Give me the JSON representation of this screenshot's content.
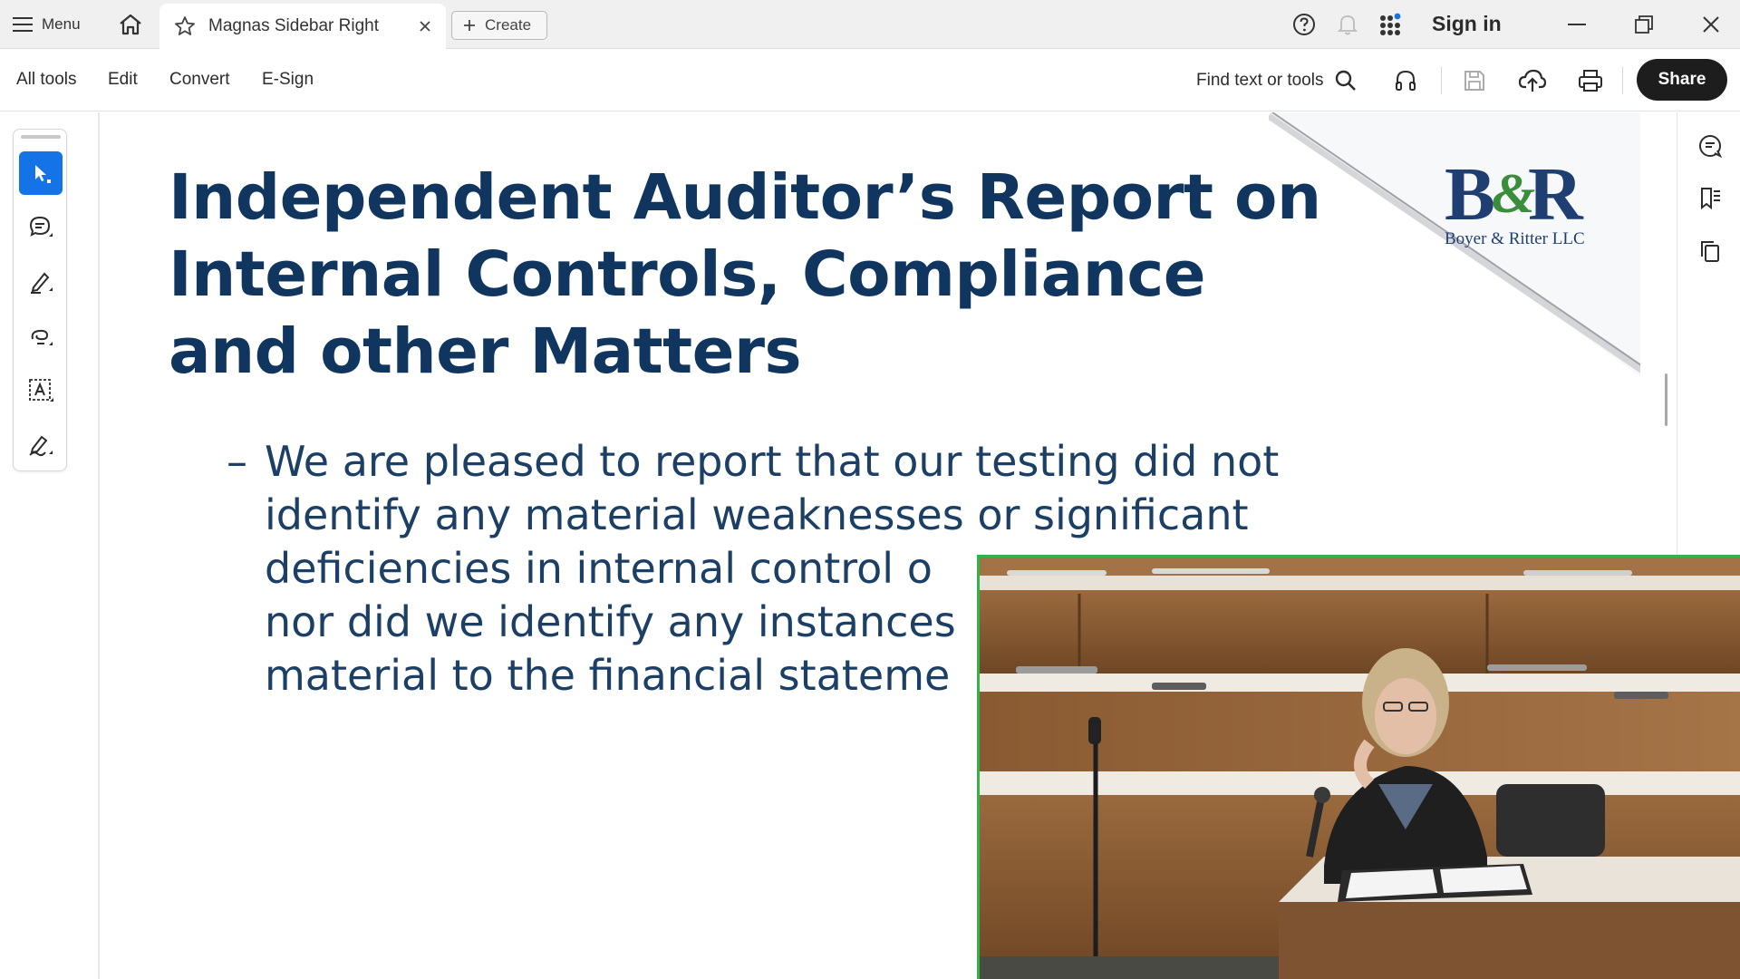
{
  "titlebar": {
    "menu_label": "Menu",
    "tab_title": "Magnas Sidebar Right",
    "create_label": "Create",
    "sign_in_label": "Sign in",
    "icons": [
      "menu-icon",
      "home-icon",
      "star-icon",
      "close-icon",
      "plus-icon",
      "help-icon",
      "bell-icon",
      "apps-grid-icon",
      "minimize-icon",
      "restore-icon",
      "window-close-icon"
    ]
  },
  "toolbar": {
    "menus": [
      "All tools",
      "Edit",
      "Convert",
      "E-Sign"
    ],
    "find_label": "Find text or tools",
    "share_label": "Share",
    "icons": [
      "search-icon",
      "read-aloud-icon",
      "save-icon",
      "upload-icon",
      "print-icon"
    ]
  },
  "left_tools": {
    "icons": [
      "select-cursor-icon",
      "comment-icon",
      "highlight-pen-icon",
      "draw-freeform-icon",
      "text-select-icon",
      "sign-icon"
    ],
    "active_index": 0
  },
  "right_rail": {
    "icons": [
      "ai-assistant-icon",
      "bookmarks-icon",
      "pages-icon"
    ]
  },
  "document": {
    "title_lines": [
      "Independent Auditor’s Report on",
      "Internal Controls, Compliance",
      "and other Matters"
    ],
    "bullet_dash": "–",
    "bullet_lines": [
      "We are pleased to report that our testing did not",
      "identify any material weaknesses or significant",
      "deficiencies in internal control o",
      "nor did we identify any instances",
      "material to the financial stateme"
    ],
    "logo": {
      "monogram": "B&R",
      "company": "Boyer & Ritter LLC",
      "brand_color": "#1f3f73",
      "accent_color": "#3a8d3a"
    },
    "title_color": "#10365f"
  },
  "video_overlay": {
    "description_icon": "video-feed",
    "border_color": "#34b34a"
  }
}
